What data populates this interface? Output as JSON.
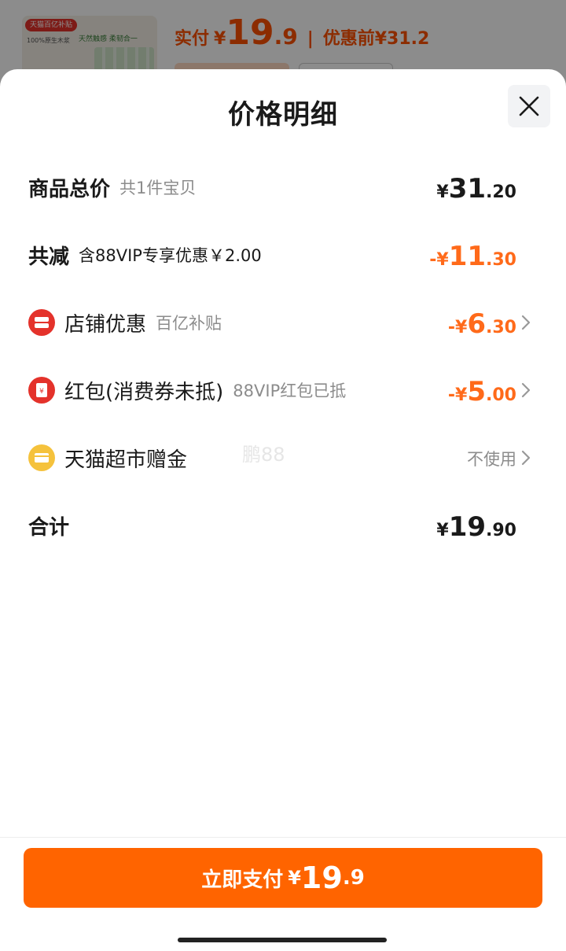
{
  "background": {
    "thumb_tag": "天猫百亿补贴",
    "thumb_caption": "100%原生木浆",
    "thumb_slogan": "天然触感 柔韧合一",
    "price_label": "实付",
    "currency": "¥",
    "price_int": "19",
    "price_dec": ".9",
    "orig_label": "优惠前",
    "orig_price": "¥31.2"
  },
  "sheet": {
    "title": "价格明细",
    "close_icon": "close-icon"
  },
  "rows": {
    "total": {
      "label": "商品总价",
      "sub": "共1件宝贝",
      "prefix": "¥",
      "int": "31",
      "dec": ".20"
    },
    "reduce": {
      "label": "共减",
      "sub": "含88VIP专享优惠￥2.00",
      "prefix": "-¥",
      "int": "11",
      "dec": ".30"
    },
    "store": {
      "label": "店铺优惠",
      "sub": "百亿补贴",
      "prefix": "-¥",
      "int": "6",
      "dec": ".30",
      "icon": "store-coupon-icon"
    },
    "redpacket": {
      "label": "红包(消费券未抵)",
      "sub": "88VIP红包已抵",
      "prefix": "-¥",
      "int": "5",
      "dec": ".00",
      "icon": "red-packet-icon"
    },
    "gift": {
      "label": "天猫超市赠金",
      "value": "不使用",
      "icon": "gift-card-icon"
    },
    "sum": {
      "label": "合计",
      "prefix": "¥",
      "int": "19",
      "dec": ".90"
    }
  },
  "watermark": "鹏88",
  "pay_button": {
    "label": "立即支付",
    "currency": "¥",
    "int": "19",
    "dec": ".9"
  },
  "colors": {
    "accent": "#ff6400",
    "discount": "#ff6a1a",
    "store_icon": "#e4322b",
    "gift_icon": "#f5c23c"
  }
}
